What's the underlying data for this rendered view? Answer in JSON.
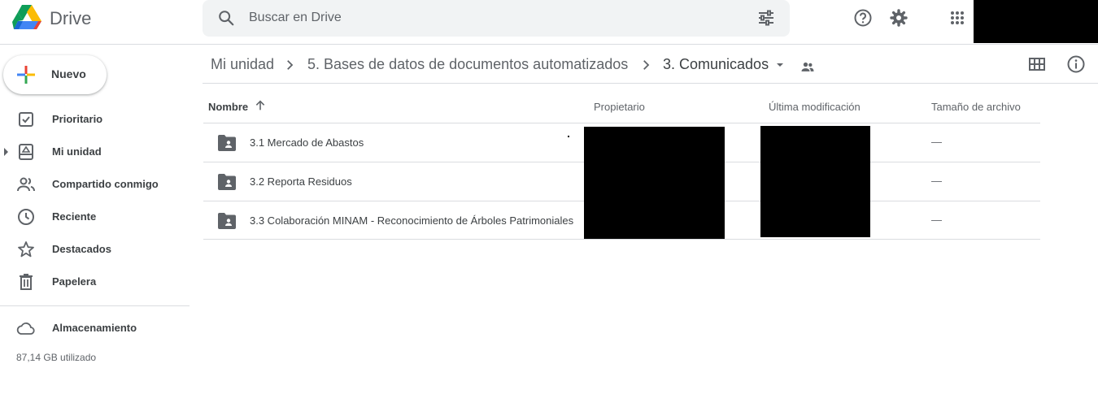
{
  "app": {
    "name": "Drive"
  },
  "search": {
    "placeholder": "Buscar en Drive"
  },
  "new_button": {
    "label": "Nuevo"
  },
  "sidebar": {
    "items": [
      {
        "label": "Prioritario",
        "icon": "priority-icon"
      },
      {
        "label": "Mi unidad",
        "icon": "my-drive-icon"
      },
      {
        "label": "Compartido conmigo",
        "icon": "shared-icon"
      },
      {
        "label": "Reciente",
        "icon": "clock-icon"
      },
      {
        "label": "Destacados",
        "icon": "star-icon"
      },
      {
        "label": "Papelera",
        "icon": "trash-icon"
      }
    ],
    "storage": {
      "label": "Almacenamiento",
      "used": "87,14 GB utilizado"
    }
  },
  "breadcrumb": {
    "items": [
      "Mi unidad",
      "5. Bases de datos de documentos automatizados",
      "3. Comunicados"
    ]
  },
  "table": {
    "columns": [
      "Nombre",
      "Propietario",
      "Última modificación",
      "Tamaño de archivo"
    ],
    "rows": [
      {
        "name": "3.1 Mercado de Abastos",
        "size": "—"
      },
      {
        "name": "3.2 Reporta Residuos",
        "size": "—"
      },
      {
        "name": "3.3 Colaboración MINAM - Reconocimiento de Árboles Patrimoniales",
        "size": "—"
      }
    ]
  },
  "colors": {
    "icon": "#5f6368",
    "text": "#3c4043",
    "search_bg": "#f1f3f4",
    "border": "#dadce0"
  }
}
